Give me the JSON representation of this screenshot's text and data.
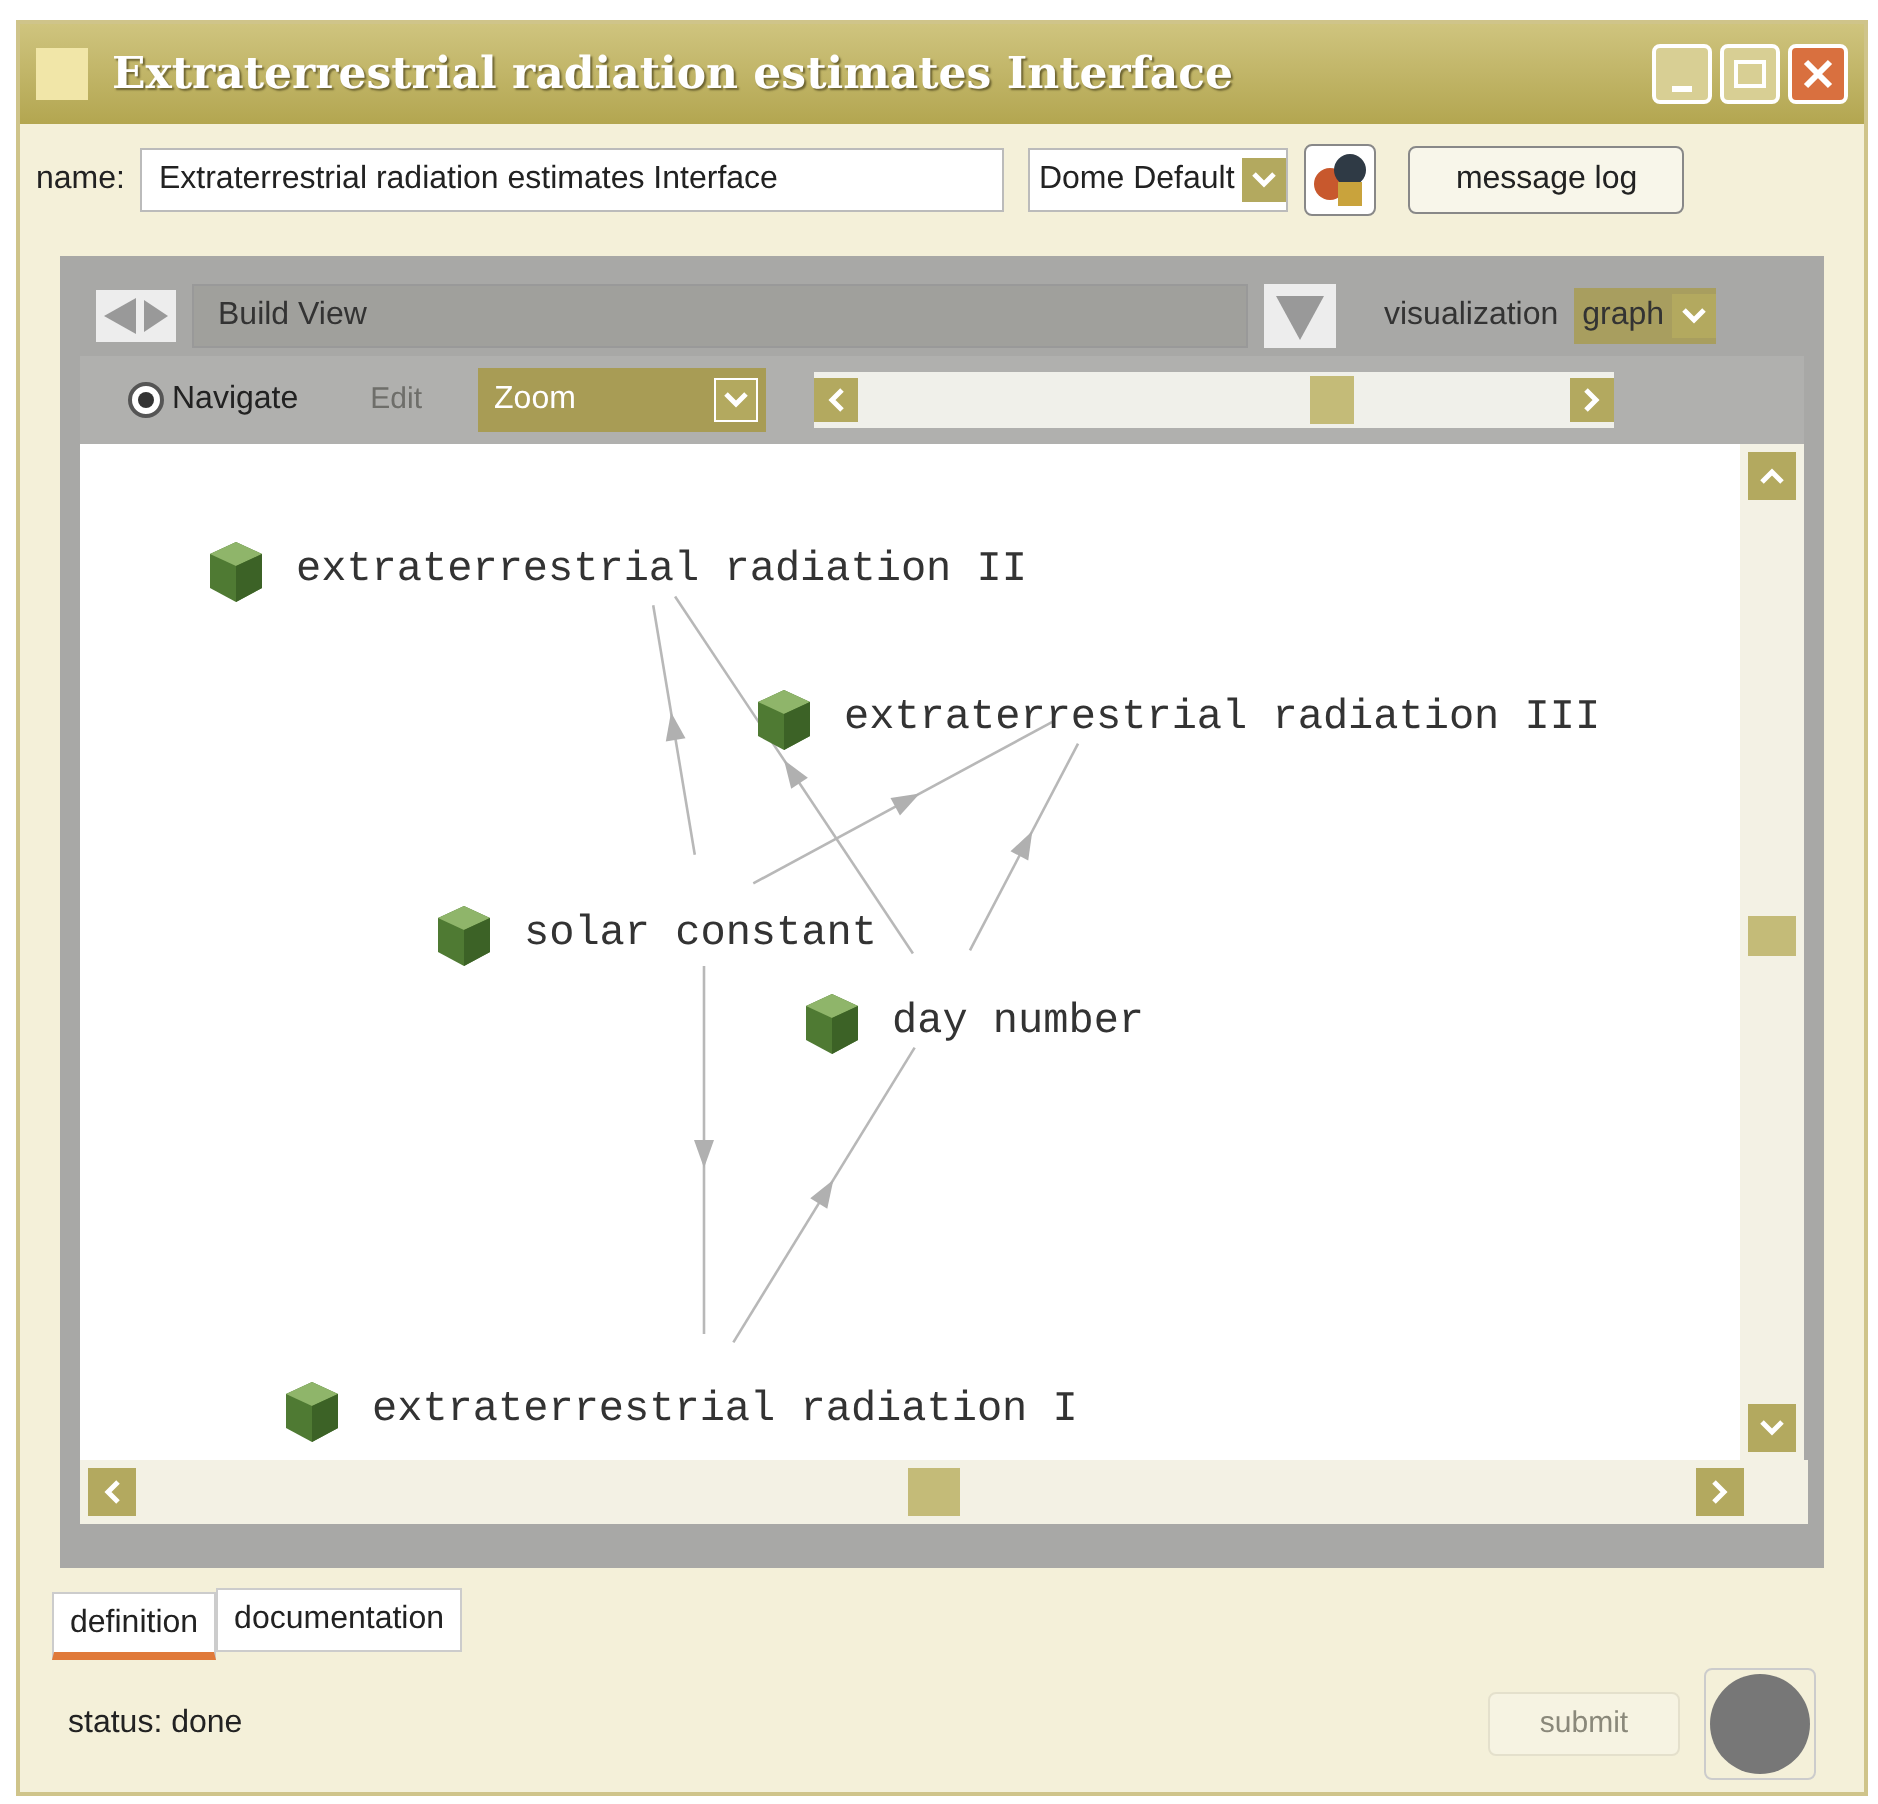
{
  "window": {
    "title": "Extraterrestrial radiation estimates Interface"
  },
  "name_field": {
    "label": "name:",
    "value": "Extraterrestrial radiation estimates Interface"
  },
  "dome_select": {
    "value": "Dome Default"
  },
  "message_log_button": {
    "label": "message log"
  },
  "view_select": {
    "value": "Build View"
  },
  "visualization": {
    "label": "visualization",
    "value": "graph"
  },
  "navigate_radio": {
    "label": "Navigate",
    "selected": true
  },
  "edit_option": {
    "label": "Edit",
    "disabled": true
  },
  "zoom_select": {
    "value": "Zoom"
  },
  "graph": {
    "nodes": [
      {
        "label": "extraterrestrial radiation II"
      },
      {
        "label": "extraterrestrial radiation III"
      },
      {
        "label": "solar constant"
      },
      {
        "label": "day number"
      },
      {
        "label": "extraterrestrial radiation I"
      }
    ]
  },
  "tabs": [
    {
      "label": "definition",
      "selected": true
    },
    {
      "label": "documentation",
      "selected": false
    }
  ],
  "status": "status: done",
  "submit_button": {
    "label": "submit",
    "disabled": true
  }
}
